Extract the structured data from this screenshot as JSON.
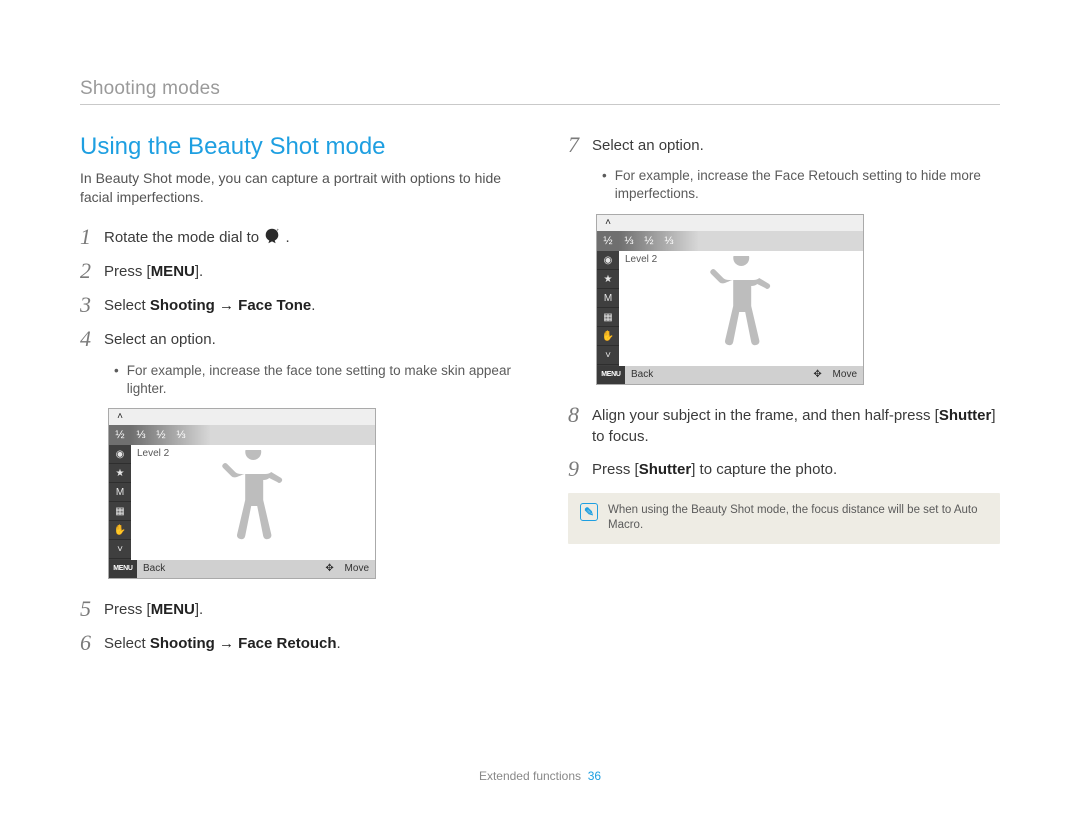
{
  "header": "Shooting modes",
  "left": {
    "title": "Using the Beauty Shot mode",
    "intro": "In Beauty Shot mode, you can capture a portrait with options to hide facial imperfections.",
    "steps": {
      "s1_pre": "Rotate the mode dial to ",
      "s1_post": ".",
      "s2_pre": "Press [",
      "s2_strong": "MENU",
      "s2_post": "].",
      "s3_pre": "Select ",
      "s3_strong": "Shooting → Face Tone",
      "s3_post": ".",
      "s4": "Select an option.",
      "s4_sub": "For example, increase the face tone setting to make skin appear lighter.",
      "s5_pre": "Press [",
      "s5_strong": "MENU",
      "s5_post": "].",
      "s6_pre": "Select ",
      "s6_strong": "Shooting → Face Retouch",
      "s6_post": "."
    },
    "shot": {
      "level": "Level 2",
      "back": "Back",
      "move": "Move",
      "menu": "MENU",
      "tabs": [
        "½",
        "⅓",
        "½",
        "⅓"
      ],
      "side": [
        "◉",
        "★",
        "M",
        "▦",
        "✋"
      ]
    }
  },
  "right": {
    "steps": {
      "s7": "Select an option.",
      "s7_sub": "For example, increase the Face Retouch setting to hide more imperfections.",
      "s8_pre": "Align your subject in the frame, and then half-press [",
      "s8_strong": "Shutter",
      "s8_post": "] to focus.",
      "s9_pre": "Press [",
      "s9_strong": "Shutter",
      "s9_post": "] to capture the photo."
    },
    "shot": {
      "level": "Level 2",
      "back": "Back",
      "move": "Move",
      "menu": "MENU",
      "tabs": [
        "½",
        "⅓",
        "½",
        "⅓"
      ],
      "side": [
        "◉",
        "★",
        "M",
        "▦",
        "✋"
      ]
    },
    "note": "When using the Beauty Shot mode, the focus distance will be set to Auto Macro."
  },
  "footer": {
    "label": "Extended functions",
    "page": "36"
  },
  "step_numbers": [
    "1",
    "2",
    "3",
    "4",
    "5",
    "6",
    "7",
    "8",
    "9"
  ],
  "mode_icon_alt": "beauty-shot-mode-icon"
}
